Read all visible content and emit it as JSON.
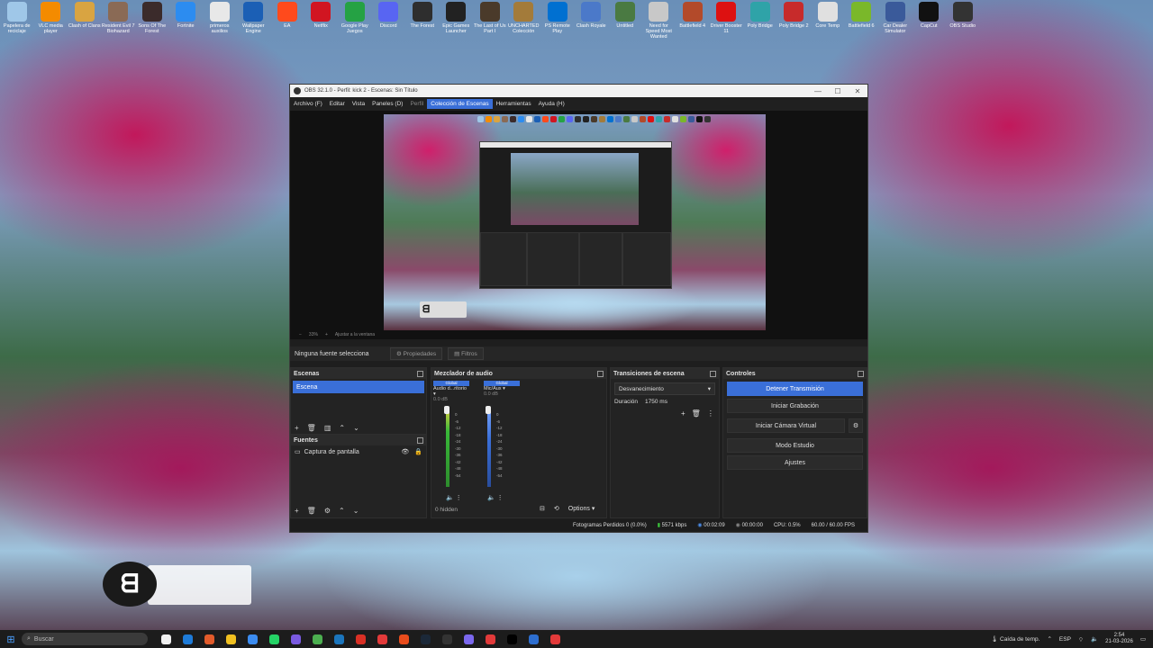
{
  "desktop_icons": [
    {
      "label": "Papelera de reciclaje",
      "color": "#9fc7e8"
    },
    {
      "label": "VLC media player",
      "color": "#f48b00"
    },
    {
      "label": "Clash of Clans",
      "color": "#d9a441"
    },
    {
      "label": "Resident Evil 7 Biohazard",
      "color": "#8a6a55"
    },
    {
      "label": "Sons Of The Forest",
      "color": "#3b2b2b"
    },
    {
      "label": "Fortnite",
      "color": "#2c8cf0"
    },
    {
      "label": "primeros auxilios",
      "color": "#e8e8e8"
    },
    {
      "label": "Wallpaper Engine",
      "color": "#1b5fb5"
    },
    {
      "label": "EA",
      "color": "#ff4a1c"
    },
    {
      "label": "Netflix",
      "color": "#d11521"
    },
    {
      "label": "Google Play Juegos",
      "color": "#25a244"
    },
    {
      "label": "Discord",
      "color": "#5865f2"
    },
    {
      "label": "The Forest",
      "color": "#2e2e2e"
    },
    {
      "label": "Epic Games Launcher",
      "color": "#222"
    },
    {
      "label": "The Last of Us Part I",
      "color": "#4a3a2a"
    },
    {
      "label": "UNCHARTED Colección",
      "color": "#a37b3a"
    },
    {
      "label": "PS Remote Play",
      "color": "#0070d1"
    },
    {
      "label": "Clash Royale",
      "color": "#4b79c9"
    },
    {
      "label": "Untitled",
      "color": "#4a7a42"
    },
    {
      "label": "Need for Speed Most Wanted",
      "color": "#c8c8c8"
    },
    {
      "label": "Battlefield 4",
      "color": "#b34a2a"
    },
    {
      "label": "Driver Booster 11",
      "color": "#d11"
    },
    {
      "label": "Poly Bridge",
      "color": "#2fa3a8"
    },
    {
      "label": "Poly Bridge 2",
      "color": "#c72b2b"
    },
    {
      "label": "Core Temp",
      "color": "#e0e0e0"
    },
    {
      "label": "Battlefield 6",
      "color": "#7ab82a"
    },
    {
      "label": "Car Dealer Simulator",
      "color": "#3a5a9a"
    },
    {
      "label": "CapCut",
      "color": "#111"
    },
    {
      "label": "OBS Studio",
      "color": "#333"
    }
  ],
  "window": {
    "title": "OBS 32.1.0 - Perfil: kick 2 - Escenas: Sin Título",
    "min": "—",
    "max": "☐",
    "close": "✕"
  },
  "menu": {
    "archivo": "Archivo (F)",
    "editar": "Editar",
    "vista": "Vista",
    "paneles": "Paneles (D)",
    "perfil": "Perfil",
    "coleccion": "Colección de Escenas",
    "herramientas": "Herramientas",
    "ayuda": "Ayuda (H)"
  },
  "zoom": {
    "pct": "33%",
    "fit": "Ajustar a la ventana"
  },
  "source_bar": {
    "label": "Ninguna fuente selecciona",
    "props": "Propiedades",
    "filters": "Filtros"
  },
  "scenes": {
    "title": "Escenas",
    "item": "Escena"
  },
  "sources": {
    "title": "Fuentes",
    "item": "Captura de pantalla"
  },
  "mixer": {
    "title": "Mezclador de audio",
    "ch1": {
      "tag": "Global",
      "name": "Audio d...ritorio",
      "db": "0.0 dB"
    },
    "ch2": {
      "tag": "Global",
      "name": "Mic/Aux",
      "db": "0.0 dB"
    },
    "scale": [
      "0",
      "-6",
      "-12",
      "-18",
      "-24",
      "-30",
      "-36",
      "-42",
      "-48",
      "-54"
    ],
    "hidden": "0 hidden",
    "options": "Options"
  },
  "transitions": {
    "title": "Transiciones de escena",
    "type": "Desvanecimiento",
    "dur_label": "Duración",
    "dur_value": "1750 ms"
  },
  "controls": {
    "title": "Controles",
    "stop": "Detener Transmisión",
    "rec": "Iniciar Grabación",
    "vcam": "Iniciar Cámara Virtual",
    "studio": "Modo Estudio",
    "settings": "Ajustes"
  },
  "status": {
    "dropped": "Fotogramas Perdidos 0 (0.0%)",
    "kbps": "5571 kbps",
    "stream_time": "00:02:09",
    "rec_time": "00:00:00",
    "cpu": "CPU: 0.5%",
    "fps": "60.00 / 60.00 FPS"
  },
  "taskbar": {
    "search": "Buscar",
    "weather": "Caída de temp.",
    "lang": "ESP",
    "time": "2:54",
    "date": "21-03-2026"
  }
}
